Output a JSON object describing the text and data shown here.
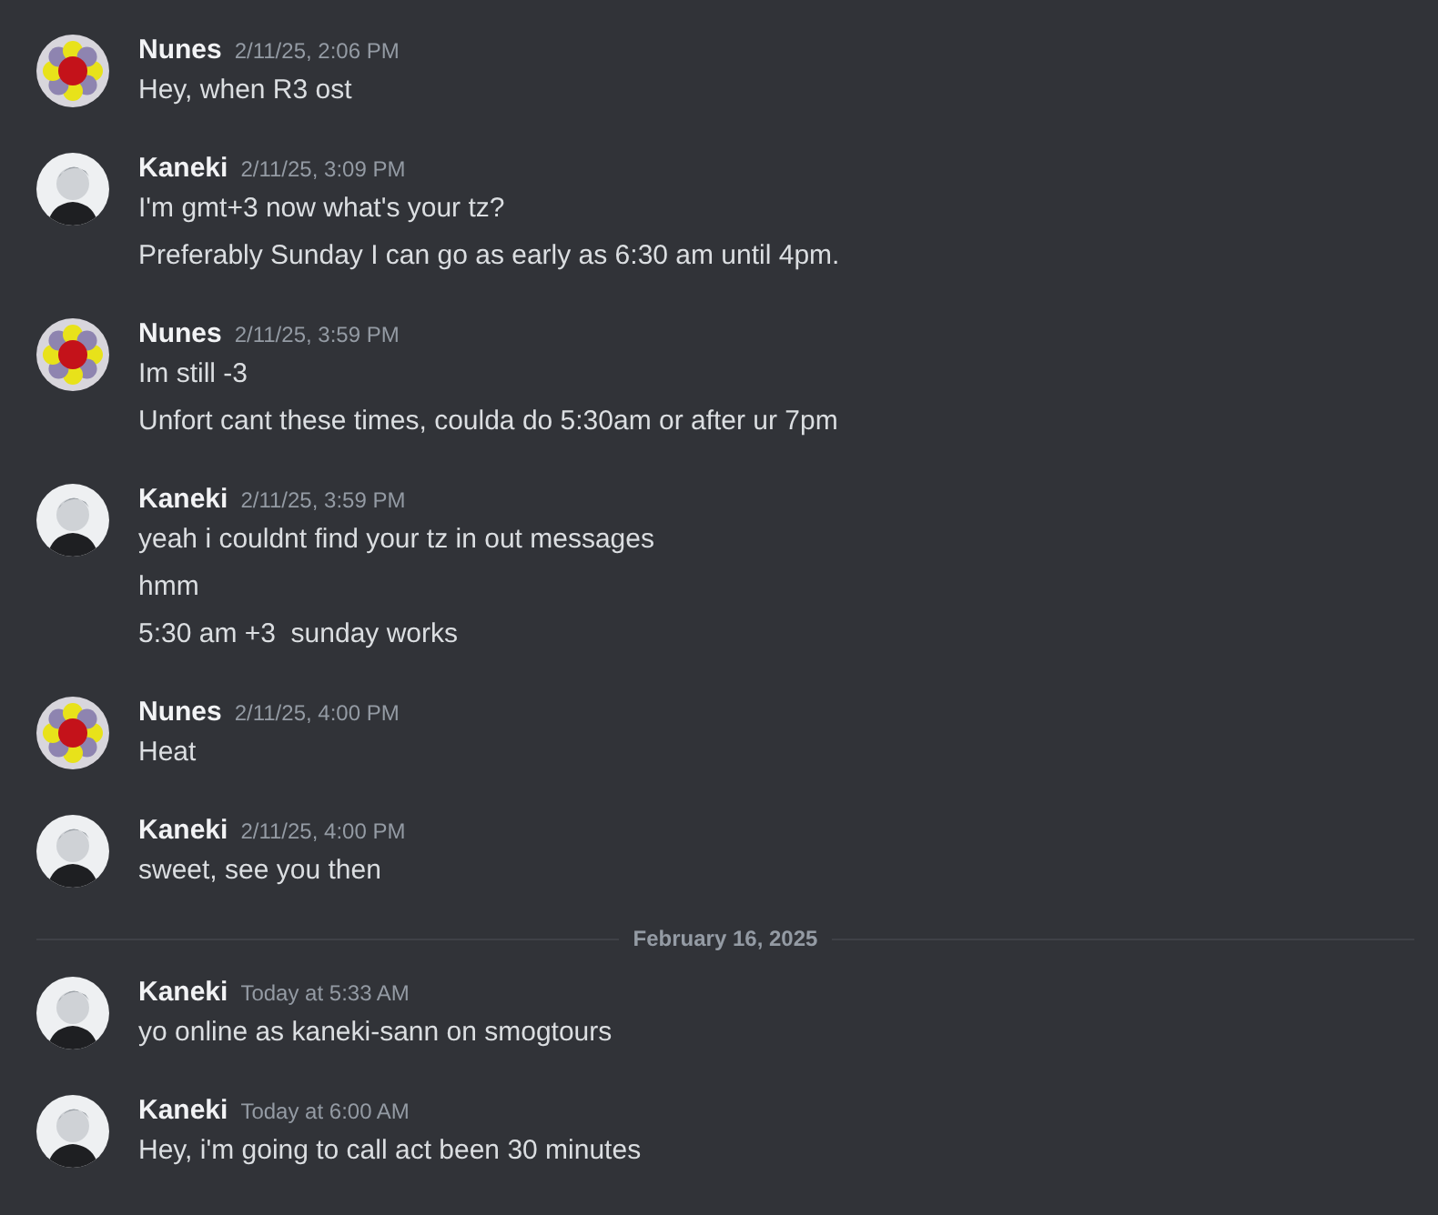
{
  "feed": [
    {
      "kind": "message",
      "author": "Nunes",
      "avatar": {
        "kind": "flower"
      },
      "time": "2/11/25, 2:06 PM",
      "lines": [
        "Hey, when R3 ost"
      ]
    },
    {
      "kind": "message",
      "author": "Kaneki",
      "avatar": {
        "kind": "person"
      },
      "time": "2/11/25, 3:09 PM",
      "lines": [
        "I'm gmt+3 now what's your tz?",
        "Preferably Sunday I can go as early as 6:30 am until 4pm."
      ]
    },
    {
      "kind": "message",
      "author": "Nunes",
      "avatar": {
        "kind": "flower"
      },
      "time": "2/11/25, 3:59 PM",
      "lines": [
        "Im still -3",
        "Unfort cant these times, coulda do 5:30am or after ur 7pm"
      ]
    },
    {
      "kind": "message",
      "author": "Kaneki",
      "avatar": {
        "kind": "person"
      },
      "time": "2/11/25, 3:59 PM",
      "lines": [
        "yeah i couldnt find your tz in out messages",
        "hmm",
        "5:30 am +3  sunday works"
      ]
    },
    {
      "kind": "message",
      "author": "Nunes",
      "avatar": {
        "kind": "flower"
      },
      "time": "2/11/25, 4:00 PM",
      "lines": [
        "Heat"
      ]
    },
    {
      "kind": "message",
      "author": "Kaneki",
      "avatar": {
        "kind": "person"
      },
      "time": "2/11/25, 4:00 PM",
      "lines": [
        "sweet, see you then"
      ]
    },
    {
      "kind": "divider",
      "label": "February 16, 2025"
    },
    {
      "kind": "message",
      "author": "Kaneki",
      "avatar": {
        "kind": "person"
      },
      "time": "Today at 5:33 AM",
      "lines": [
        "yo online as kaneki-sann on smogtours"
      ]
    },
    {
      "kind": "message",
      "author": "Kaneki",
      "avatar": {
        "kind": "person"
      },
      "time": "Today at 6:00 AM",
      "lines": [
        "Hey, i'm going to call act been 30 minutes"
      ]
    }
  ]
}
